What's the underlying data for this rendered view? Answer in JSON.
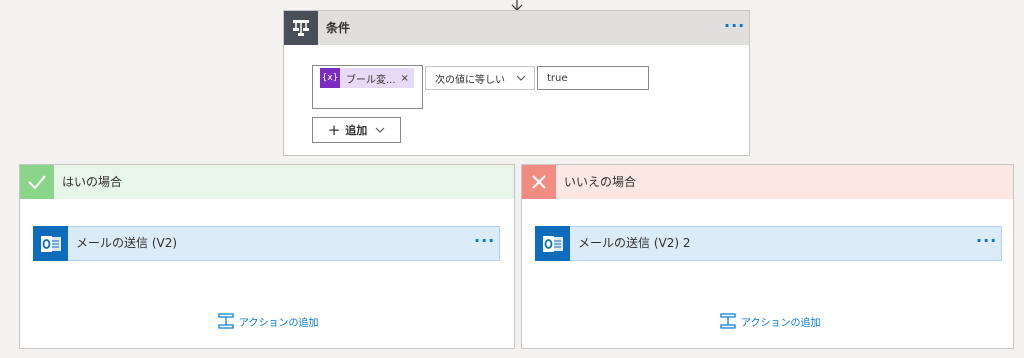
{
  "condition": {
    "title": "条件",
    "more": "···",
    "token_icon_text": "{x}",
    "token_label": "ブール変...",
    "token_remove": "×",
    "operator": "次の値に等しい",
    "value": "true",
    "add_button_label": "追加"
  },
  "yes_branch": {
    "title": "はいの場合",
    "action_title": "メールの送信 (V2)",
    "more": "···",
    "add_action_label": "アクションの追加"
  },
  "no_branch": {
    "title": "いいえの場合",
    "action_title": "メールの送信 (V2) 2",
    "more": "···",
    "add_action_label": "アクションの追加"
  },
  "colors": {
    "accent": "#0078d4",
    "condition_icon_bg": "#484f58",
    "yes_icon_bg": "#8bd58b",
    "no_icon_bg": "#f28b82",
    "token_bg": "#7b2bbf",
    "outlook_blue": "#0f6cbd"
  },
  "icons": {
    "condition": "condition-icon",
    "yes": "check-icon",
    "no": "close-icon",
    "action": "outlook-icon",
    "add_action": "add-action-icon"
  }
}
